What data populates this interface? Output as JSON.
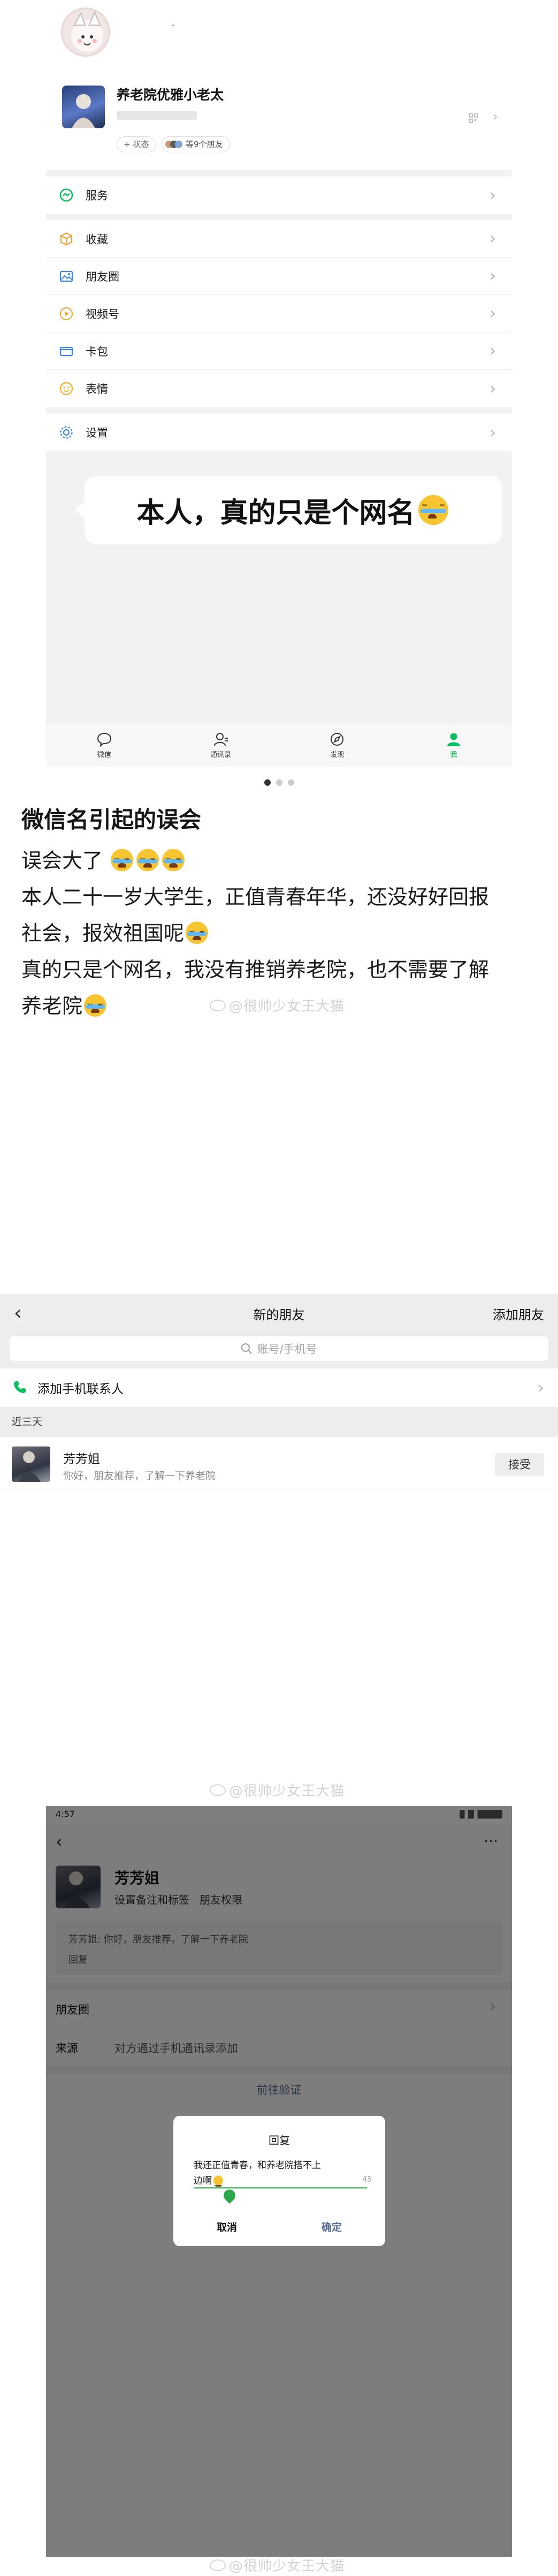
{
  "me_page": {
    "username": "养老院优雅小老太",
    "status_button": "+ 状态",
    "friends_status": "等9个朋友",
    "menu": [
      {
        "label": "服务",
        "icon": "service-icon"
      },
      {
        "label": "收藏",
        "icon": "favorites-cube-icon"
      },
      {
        "label": "朋友圈",
        "icon": "moments-image-icon"
      },
      {
        "label": "视频号",
        "icon": "channels-icon"
      },
      {
        "label": "卡包",
        "icon": "card-wallet-icon"
      },
      {
        "label": "表情",
        "icon": "sticker-smile-icon"
      },
      {
        "label": "设置",
        "icon": "settings-gear-icon"
      }
    ],
    "bubble_text": "本人，真的只是个网名",
    "tabbar": [
      {
        "label": "微信",
        "icon": "chat-bubble-icon"
      },
      {
        "label": "通讯录",
        "icon": "contacts-icon"
      },
      {
        "label": "发现",
        "icon": "discover-compass-icon"
      },
      {
        "label": "我",
        "icon": "me-person-icon"
      }
    ]
  },
  "post": {
    "title": "微信名引起的误会",
    "lines": [
      "误会大了",
      "本人二十一岁大学生，正值青春年华，还没好好回报",
      "社会，报效祖国呢",
      "真的只是个网名，我没有推销养老院，也不需要了解",
      "养老院"
    ],
    "watermark": "@很帅少女王大猫"
  },
  "new_friends": {
    "title": "新的朋友",
    "add_friend": "添加朋友",
    "search_placeholder": "账号/手机号",
    "add_contacts": "添加手机联系人",
    "section_label": "近三天",
    "request": {
      "name": "芳芳姐",
      "message": "你好，朋友推荐，了解一下养老院",
      "accept_label": "接受"
    }
  },
  "profile_dialog": {
    "status_time": "4:57",
    "more": "···",
    "profile_name": "芳芳姐",
    "profile_links": "设置备注和标签   朋友权限",
    "request_msg": "芳芳姐: 你好，朋友推荐，了解一下养老院",
    "reply_label": "回复",
    "moments_label": "朋友圈",
    "source_label": "来源",
    "source_value": "对方通过手机通讯录添加",
    "bottom_button": "前往验证",
    "dialog": {
      "title": "回复",
      "text_line1": "我还正值青春，和养老院搭不上",
      "text_line2": "边啊",
      "counter": "43",
      "cancel": "取消",
      "confirm": "确定"
    }
  },
  "colors": {
    "wechat_green": "#07c160",
    "dialog_confirm": "#576b95",
    "bg_grey": "#f2f2f2"
  }
}
